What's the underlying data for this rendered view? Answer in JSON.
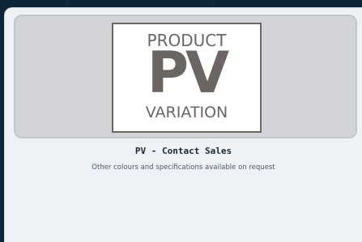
{
  "product": {
    "image": {
      "logo_line_1": "PRODUCT",
      "logo_line_2": "PV",
      "logo_line_3": "VARIATION"
    },
    "title": "PV - Contact Sales",
    "description": "Other colours and specifications available on request"
  },
  "colors": {
    "page_background": "#0f2537",
    "card_background": "#eef2f6",
    "image_background": "#d2d3d6",
    "logo_color": "#6b6564"
  }
}
